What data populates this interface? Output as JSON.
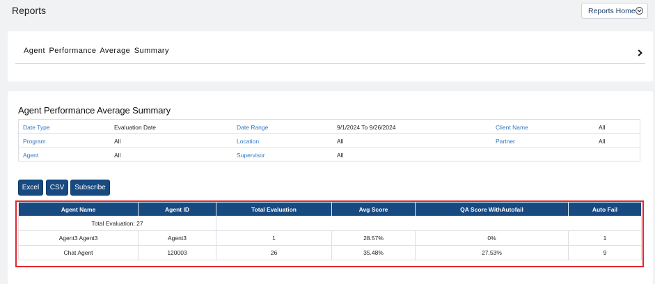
{
  "header": {
    "title": "Reports",
    "reports_home_label": "Reports Home"
  },
  "breadcrumb_card": {
    "title": "Agent Performance Average Summary"
  },
  "report": {
    "title": "Agent Performance Average Summary",
    "filters": [
      [
        {
          "label": "Date Type",
          "value": "Evaluation Date"
        },
        {
          "label": "Date Range",
          "value": "9/1/2024 To 9/26/2024"
        },
        {
          "label": "Client Name",
          "value": "All"
        }
      ],
      [
        {
          "label": "Program",
          "value": "All"
        },
        {
          "label": "Location",
          "value": "All"
        },
        {
          "label": "Partner",
          "value": "All"
        }
      ],
      [
        {
          "label": "Agent",
          "value": "All"
        },
        {
          "label": "Supervisor",
          "value": "All"
        }
      ]
    ],
    "buttons": {
      "excel": "Excel",
      "csv": "CSV",
      "subscribe": "Subscribe"
    },
    "table": {
      "columns": [
        "Agent Name",
        "Agent ID",
        "Total Evaluation",
        "Avg Score",
        "QA Score WithAutofail",
        "Auto Fail"
      ],
      "total_row": "Total Evaluation: 27",
      "rows": [
        [
          "Agent3 Agent3",
          "Agent3",
          "1",
          "28.57%",
          "0%",
          "1"
        ],
        [
          "Chat Agent",
          "120003",
          "26",
          "35.48%",
          "27.53%",
          "9"
        ]
      ]
    }
  },
  "colors": {
    "primary": "#184a82",
    "link": "#2f78c4",
    "highlight": "#e3262d",
    "background": "#f1f2f4"
  }
}
